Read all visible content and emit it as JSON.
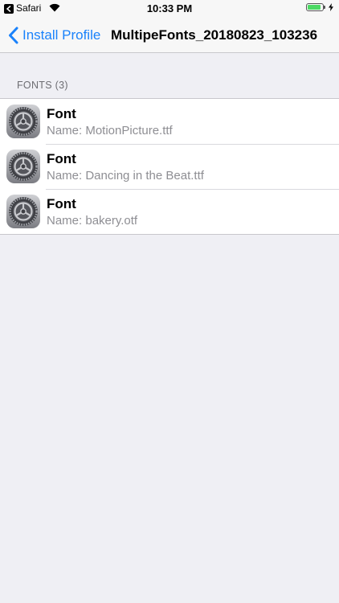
{
  "status_bar": {
    "app_name": "Safari",
    "time": "10:33 PM",
    "battery_level": 0.9,
    "icons": [
      "back-to-app-icon",
      "wifi-icon",
      "battery-icon",
      "charging-bolt-icon"
    ]
  },
  "nav": {
    "back_label": "Install Profile",
    "title": "MultipeFonts_20180823_103236"
  },
  "section": {
    "header": "FONTS (3)"
  },
  "fonts": [
    {
      "title": "Font",
      "subtitle": "Name: MotionPicture.ttf",
      "icon": "settings-gear-icon"
    },
    {
      "title": "Font",
      "subtitle": "Name: Dancing in the Beat.ttf",
      "icon": "settings-gear-icon"
    },
    {
      "title": "Font",
      "subtitle": "Name: bakery.otf",
      "icon": "settings-gear-icon"
    }
  ],
  "colors": {
    "accent": "#1a82fb",
    "background": "#efeff4",
    "battery": "#4cd964",
    "secondary_text": "#8e8e93"
  }
}
